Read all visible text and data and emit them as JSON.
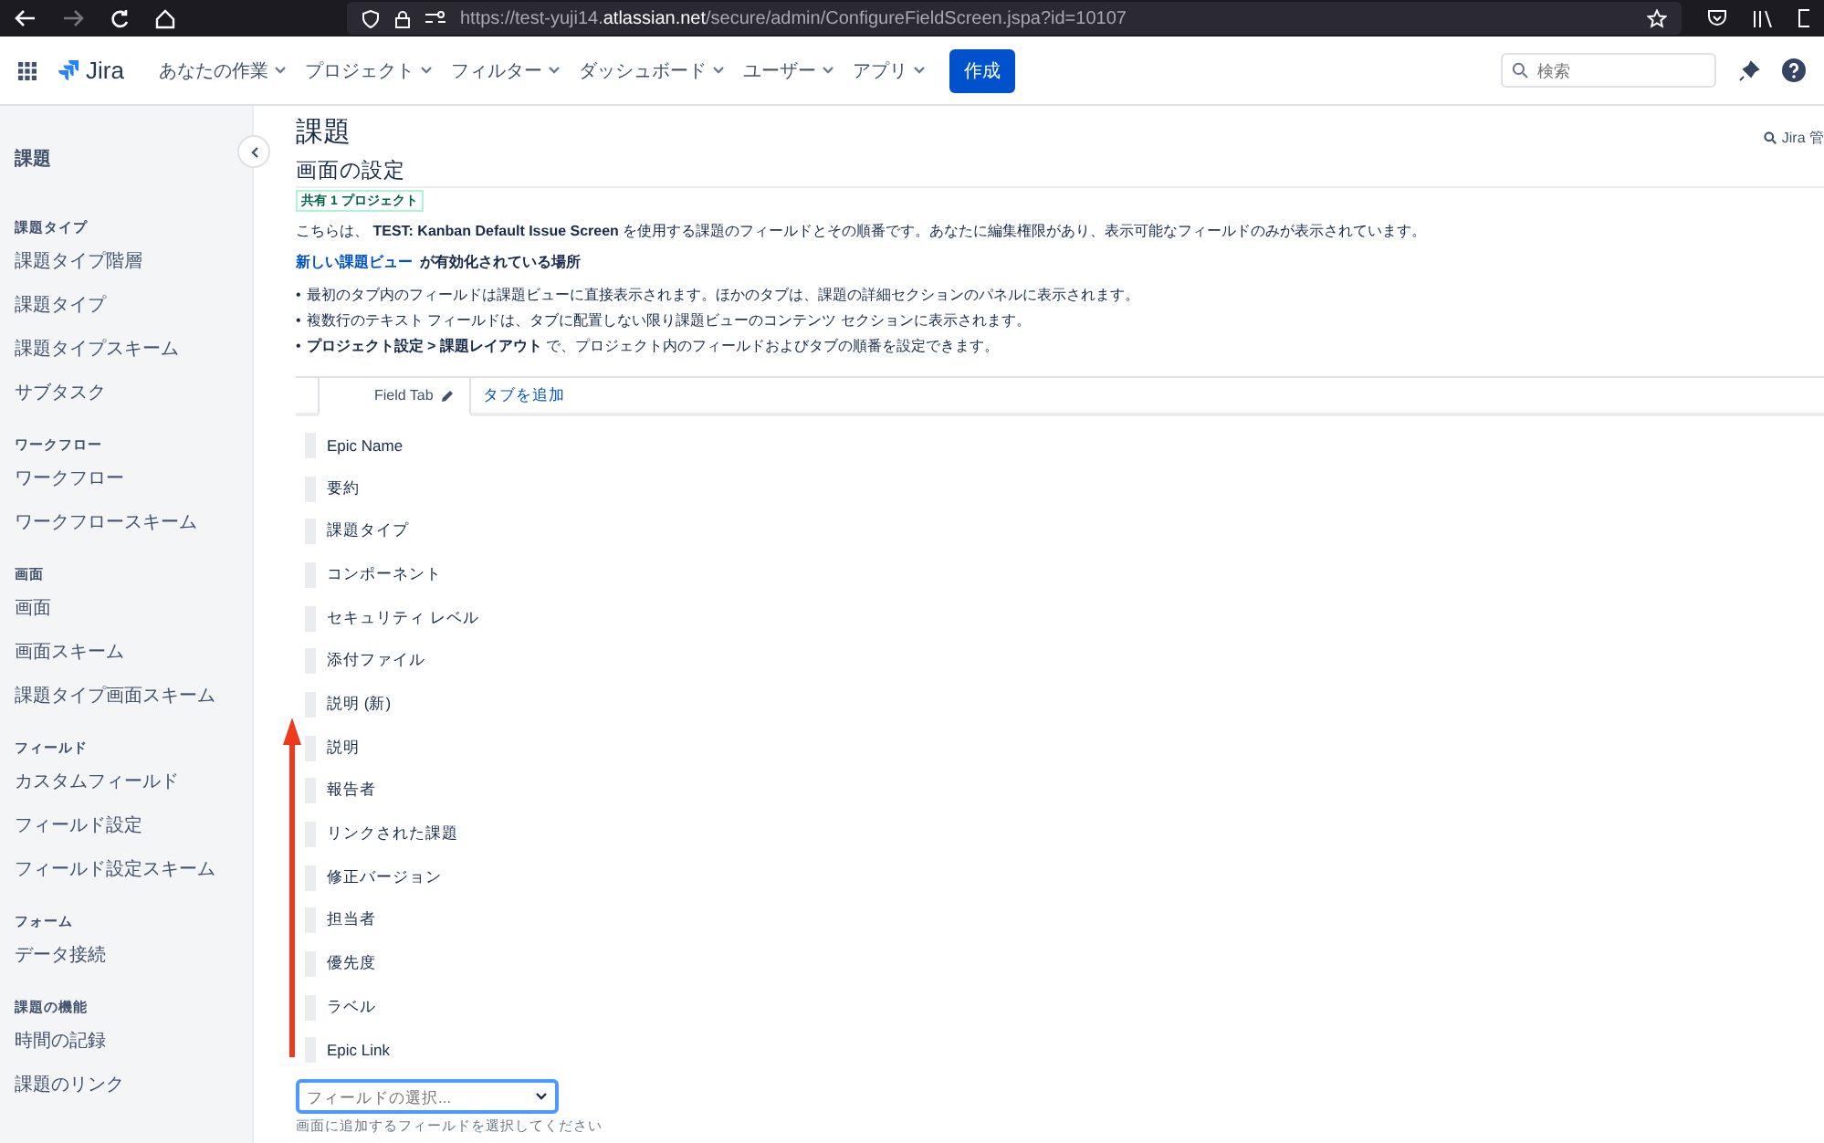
{
  "browser": {
    "url": "https://test-yuji14.**atlassian.net**/secure/admin/ConfigureFieldScreen.jspa?id=10107"
  },
  "nav": {
    "app_name": "Jira",
    "menus": [
      "あなたの作業",
      "プロジェクト",
      "フィルター",
      "ダッシュボード",
      "ユーザー",
      "アプリ"
    ],
    "create_button": "作成",
    "search": {
      "placeholder": "検索"
    }
  },
  "sidebar": {
    "title": "課題",
    "sections": [
      {
        "heading": "課題タイプ",
        "items": [
          "課題タイプ階層",
          "課題タイプ",
          "課題タイプスキーム",
          "サブタスク"
        ]
      },
      {
        "heading": "ワークフロー",
        "items": [
          "ワークフロー",
          "ワークフロースキーム"
        ]
      },
      {
        "heading": "画面",
        "items": [
          "画面",
          "画面スキーム",
          "課題タイプ画面スキーム"
        ]
      },
      {
        "heading": "フィールド",
        "items": [
          "カスタムフィールド",
          "フィールド設定",
          "フィールド設定スキーム"
        ]
      },
      {
        "heading": "フォーム",
        "items": [
          "データ接続"
        ]
      },
      {
        "heading": "課題の機能",
        "items": [
          "時間の記録",
          "課題のリンク"
        ]
      }
    ]
  },
  "main": {
    "page_title": "課題",
    "admin_search": "Jira 管",
    "section_title": "画面の設定",
    "badge": "共有 1 プロジェクト",
    "description": "こちらは、 **TEST: Kanban Default Issue Screen** を使用する課題のフィールドとその順番です。あなたに編集権限があり、表示可能なフィールドのみが表示されています。",
    "notice": {
      "link": "新しい課題ビュー",
      "text": "が有効化されている場所"
    },
    "bullets": [
      {
        "marker": "•",
        "text": "最初のタブ内のフィールドは課題ビューに直接表示されます。ほかのタブは、課題の詳細セクションのパネルに表示されます。"
      },
      {
        "marker": "•",
        "text": "複数行のテキスト フィールドは、タブに配置しない限り課題ビューのコンテンツ セクションに表示されます。"
      },
      {
        "marker": "•",
        "text": "**プロジェクト設定 > 課題レイアウト** で、プロジェクト内のフィールドおよびタブの順番を設定できます。"
      }
    ],
    "tabs": [
      {
        "label": "Field Tab",
        "selected": true
      }
    ],
    "add_tab": "タブを追加",
    "fields": [
      "Epic Name",
      "要約",
      "課題タイプ",
      "コンポーネント",
      "セキュリティ レベル",
      "添付ファイル",
      "説明 (新)",
      "説明",
      "報告者",
      "リンクされた課題",
      "修正バージョン",
      "担当者",
      "優先度",
      "ラベル",
      "Epic Link"
    ],
    "field_select": {
      "placeholder": "フィールドの選択..."
    },
    "field_select_hint": "画面に追加するフィールドを選択してください"
  }
}
